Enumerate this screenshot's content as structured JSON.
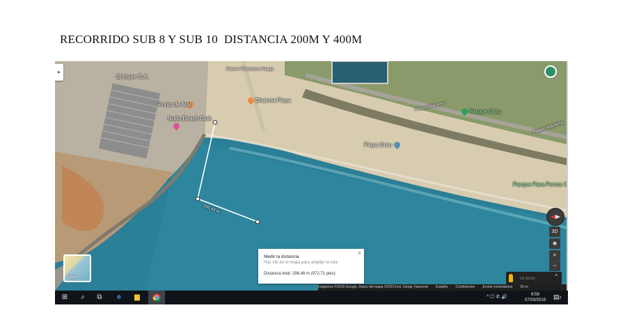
{
  "document": {
    "title": "RECORRIDO SUB 8 Y SUB 10  DISTANCIA 200M Y 400M"
  },
  "map": {
    "labels": {
      "business_top": "Bj impre S.A.",
      "dharma": "Dharma Playa",
      "mar": "Porito de Mar",
      "nudo": "Nudo Beach Club",
      "street_top": "Paseo Francisco Aliaga",
      "street_right": "Paseo Marítimo",
      "street_far": "Paseo Marítimo",
      "park": "Parque Grau",
      "beach": "Playa Grau",
      "dog_park": "Parque Para Perros C",
      "segment_distance": "296,48 m"
    },
    "layer_label": "Mapa",
    "measure": {
      "title": "Medir la distancia",
      "hint": "Haz clic en el mapa para ampliar la ruta",
      "total": "Distancia total: 296,48 m (972,71 pies)",
      "close": "×"
    },
    "controls": {
      "three_d": "3D",
      "zoom_in": "+",
      "zoom_out": "−",
      "locate": "◉",
      "expand": "⌃"
    },
    "attribution": [
      "Imágenes ©2019 Google, Datos del mapa ©2019 Inst. Geogr. Nacional",
      "España",
      "Condiciones",
      "Enviar comentarios",
      "50 m"
    ]
  },
  "taskbar": {
    "clock_time": "8:58",
    "clock_date": "07/03/2019",
    "tray_icons": "^ ☐ ✆ 🔊",
    "notification_count": "2"
  },
  "icon_names": [
    "windows-start-icon",
    "search-icon",
    "task-view-icon",
    "edge-icon",
    "file-explorer-icon",
    "chrome-icon",
    "compass-icon",
    "pegman-icon"
  ]
}
